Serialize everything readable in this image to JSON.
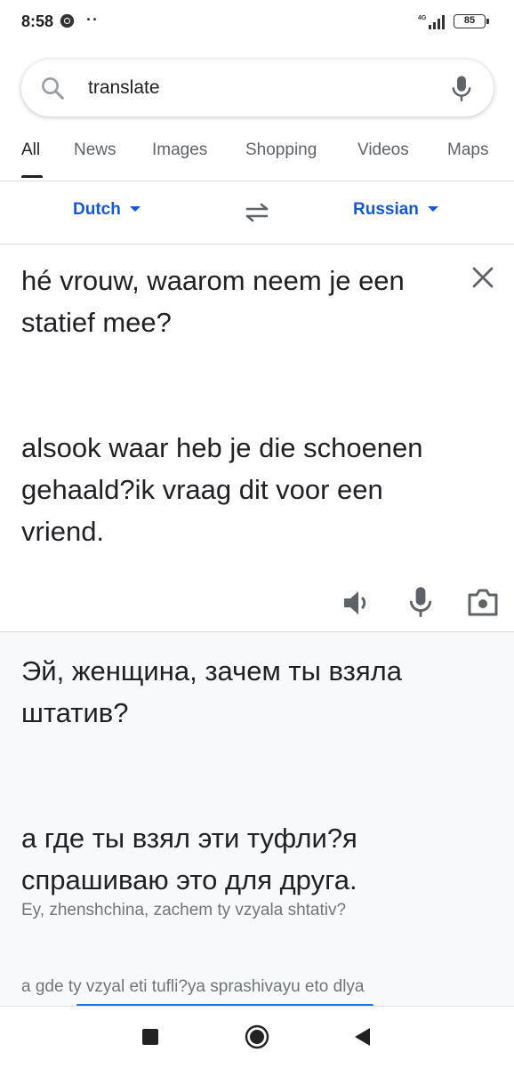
{
  "status_bar": {
    "time": "8:58",
    "dots": "··",
    "network": "4G",
    "battery": "85"
  },
  "search": {
    "query": "translate",
    "icons": [
      "search-icon",
      "mic-icon"
    ]
  },
  "tabs": [
    {
      "label": "All",
      "active": true
    },
    {
      "label": "News",
      "active": false
    },
    {
      "label": "Images",
      "active": false
    },
    {
      "label": "Shopping",
      "active": false
    },
    {
      "label": "Videos",
      "active": false
    },
    {
      "label": "Maps",
      "active": false
    }
  ],
  "translator": {
    "source_lang": "Dutch",
    "target_lang": "Russian",
    "source_text": "hé vrouw, waarom neem je een statief mee?\n\n\nalsook waar heb je die schoenen gehaald?ik vraag dit voor een vriend.",
    "translated_text": "Эй, женщина, зачем ты взяла штатив?\n\n\nа где ты взял эти туфли?я спрашиваю это для друга.",
    "transliteration_1": "Ey, zhenshchina, zachem ty vzyala shtativ?",
    "transliteration_2": "a gde ty vzyal eti tufli?ya sprashivayu eto dlya"
  },
  "colors": {
    "accent": "#1558d6",
    "result_bg": "#f8f9fa",
    "muted": "#70757a"
  }
}
